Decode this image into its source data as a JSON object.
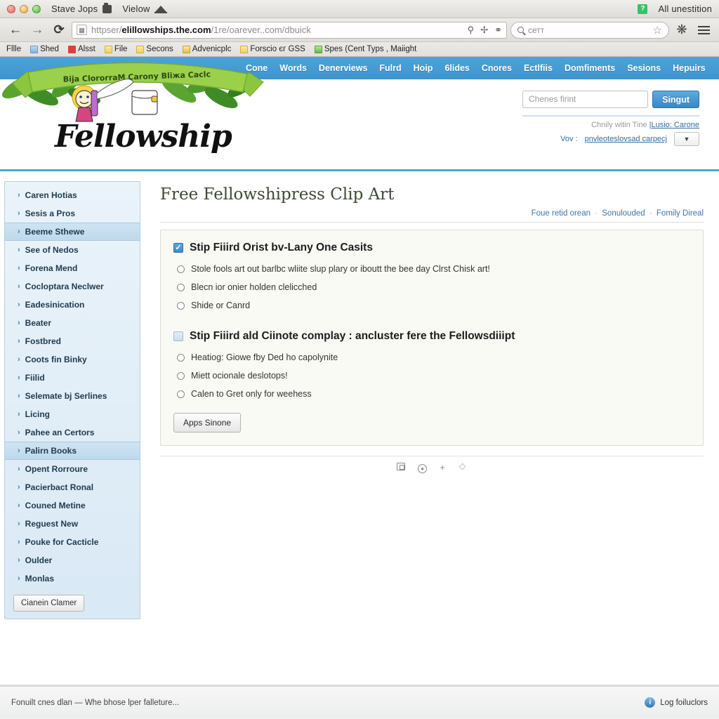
{
  "titlebar": {
    "app_label": "Stave Jops",
    "menu_label": "Vielow",
    "tab_label": "All unestition",
    "window_icon": "briefcase-icon",
    "bridge_icon": "bridge-icon",
    "green_badge_icon": "tab-badge-icon",
    "window_button_icon": "window-button-icon"
  },
  "navbar": {
    "back_icon": "back-arrow-icon",
    "forward_icon": "forward-arrow-icon",
    "reload_icon": "reload-icon",
    "favicon": "site-favicon",
    "url_prefix": "httpser/",
    "url_bold": "elillowships.the.com",
    "url_suffix": "/1re/oarever..com/dbuick",
    "url_icon_1": "key-icon",
    "url_icon_2": "wrench-icon",
    "url_icon_3": "shield-icon",
    "search_placeholder": "сетт",
    "search_value": "сетт",
    "search_icon": "magnifier-icon",
    "bookmark_star_icon": "star-icon",
    "extension_icon": "extension-icon",
    "menu_icon": "hamburger-menu-icon"
  },
  "bookmarks": [
    {
      "label": "Fllle",
      "icon": "none"
    },
    {
      "label": "Shed",
      "icon": "blue-folder-icon"
    },
    {
      "label": "Alsst",
      "icon": "red-icon"
    },
    {
      "label": "File",
      "icon": "folder-icon"
    },
    {
      "label": "Secons",
      "icon": "folder-icon"
    },
    {
      "label": "Advenicplc",
      "icon": "gold-folder-icon"
    },
    {
      "label": "Forscio єг GSЅ",
      "icon": "folder-icon"
    },
    {
      "label": "Spes (Cent Typs , Maiight",
      "icon": "green-folder-icon"
    }
  ],
  "site": {
    "banner_ribbon_text": "Biбја ClororrаM Carony Bliжа Caclc",
    "logo_word": "Fellowship",
    "topnav": [
      "Cone",
      "Words",
      "Denerviews",
      "Fulrd",
      "Hoip",
      "6lides",
      "Cnores",
      "Ectlfiis",
      "Domfiments",
      "Sesions",
      "Hepuirs"
    ],
    "login": {
      "input_placeholder": "Chenes firint",
      "input_value": "Chenes firint",
      "button_label": "Singut"
    },
    "account_line_prefix": "Chnily witin Tine",
    "account_line_link": "|Lusio: Carone",
    "account_line2_prefix": "Vov :",
    "account_line2_link": "pnvleoteslovsad carpeсј",
    "caret_icon": "chevron-down-icon"
  },
  "sidebar": {
    "items": [
      {
        "label": "Caren Hotias",
        "selected": false
      },
      {
        "label": "Sesis a Pros",
        "selected": false
      },
      {
        "label": "Beeme Sthewe",
        "selected": true
      },
      {
        "label": "See of Nedos",
        "selected": false
      },
      {
        "label": "Forena Mend",
        "selected": false
      },
      {
        "label": "Cocloptara Neclwer",
        "selected": false
      },
      {
        "label": "Eadesinication",
        "selected": false
      },
      {
        "label": "Beater",
        "selected": false
      },
      {
        "label": "Fostbred",
        "selected": false
      },
      {
        "label": "Coots fin Binky",
        "selected": false
      },
      {
        "label": "Fiilid",
        "selected": false
      },
      {
        "label": "Selemate bј Serlines",
        "selected": false
      },
      {
        "label": "Licing",
        "selected": false
      },
      {
        "label": "Pahee an Certors",
        "selected": false
      },
      {
        "label": "Palirn Books",
        "selected": true
      },
      {
        "label": "Opent Rorroure",
        "selected": false
      },
      {
        "label": "Pacierbact Ronal",
        "selected": false
      },
      {
        "label": "Couned Metine",
        "selected": false
      },
      {
        "label": "Reguest New",
        "selected": false
      },
      {
        "label": "Pouke for Cacticle",
        "selected": false
      },
      {
        "label": "Oulder",
        "selected": false
      },
      {
        "label": "Monlas",
        "selected": false
      }
    ],
    "chevron_icon": "chevron-right-icon",
    "button_label": "Cianein Clamer"
  },
  "main": {
    "title": "Free Fellowshipress Clip Art",
    "crumbs": [
      "Foue retid orean",
      "Sonulouded",
      "Fomily Direal"
    ],
    "crumb_separator": "·",
    "sections": [
      {
        "checkbox_state": "checked",
        "checkbox_glyph": "✓",
        "heading": "Stip Fiiird Orist bv-Lany One Casits",
        "options": [
          "Stole fools art out barlbc wliite slup plary  or iboutt the bee day Clrst Chisk art!",
          "Blecn іor onier holden clelicched",
          "Shide or Canrd"
        ]
      },
      {
        "checkbox_state": "unchecked",
        "checkbox_glyph": "",
        "heading": "Stip Fiiird ald Ciinote complay : ancluster fere the Fellowsdіiipt",
        "options": [
          "Heatiog: Giowe fby Ded ho capolynite",
          "Miett ocionale deslotops!",
          "Calen to Gret only for weehess"
        ]
      }
    ],
    "apply_button": "Apps Sinone",
    "toolbar_icons": [
      "insert-object-icon",
      "record-icon",
      "add-icon",
      "diamond-icon"
    ],
    "add_glyph": "+",
    "record_glyph": "●"
  },
  "statusbar": {
    "message": "Fonuilt cnes dlan — Whe bhose lper falleture...",
    "right_label": "Log foiluclors",
    "info_icon": "info-icon",
    "info_glyph": "i"
  },
  "colors": {
    "accent_blue": "#4aa0d5",
    "nav_blue": "#3e94cd",
    "sidebar_blue": "#d9e9f5",
    "panel_bg": "#fafaf4",
    "link_blue": "#3c76ab",
    "title_green": "#3e4a33"
  }
}
